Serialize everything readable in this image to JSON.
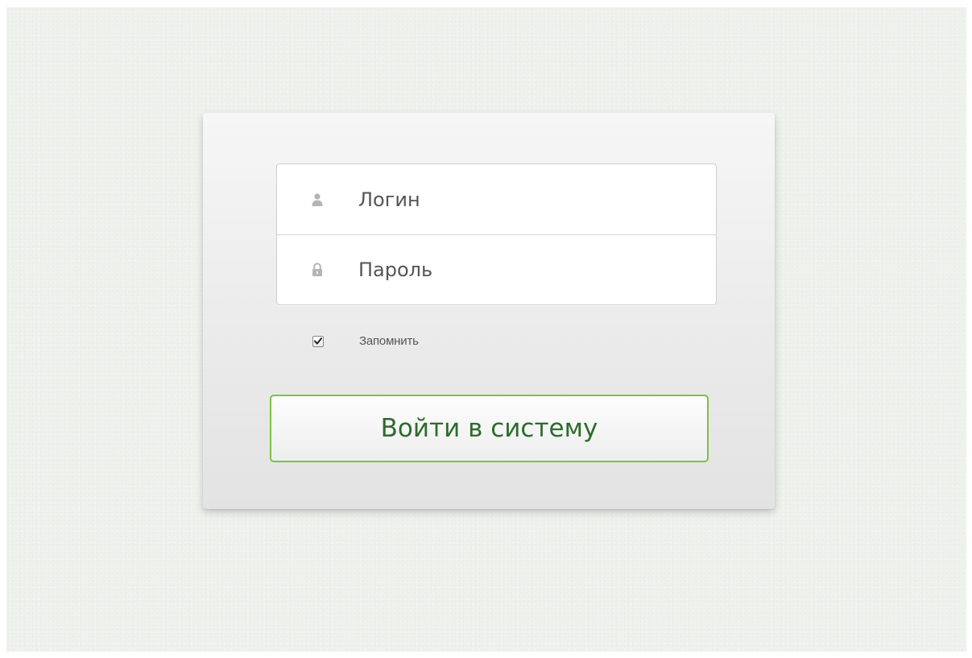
{
  "login_form": {
    "username": {
      "placeholder": "Логин",
      "value": "",
      "icon": "user-icon"
    },
    "password": {
      "placeholder": "Пароль",
      "value": "",
      "icon": "lock-icon"
    },
    "remember": {
      "label": "Запомнить",
      "checked": true
    },
    "submit_label": "Войти в систему"
  },
  "colors": {
    "background": "#eef1ec",
    "card": "#eeeeee",
    "button_border": "#7cc245",
    "button_text": "#2e6b2d",
    "icon": "#b4b4b4"
  }
}
